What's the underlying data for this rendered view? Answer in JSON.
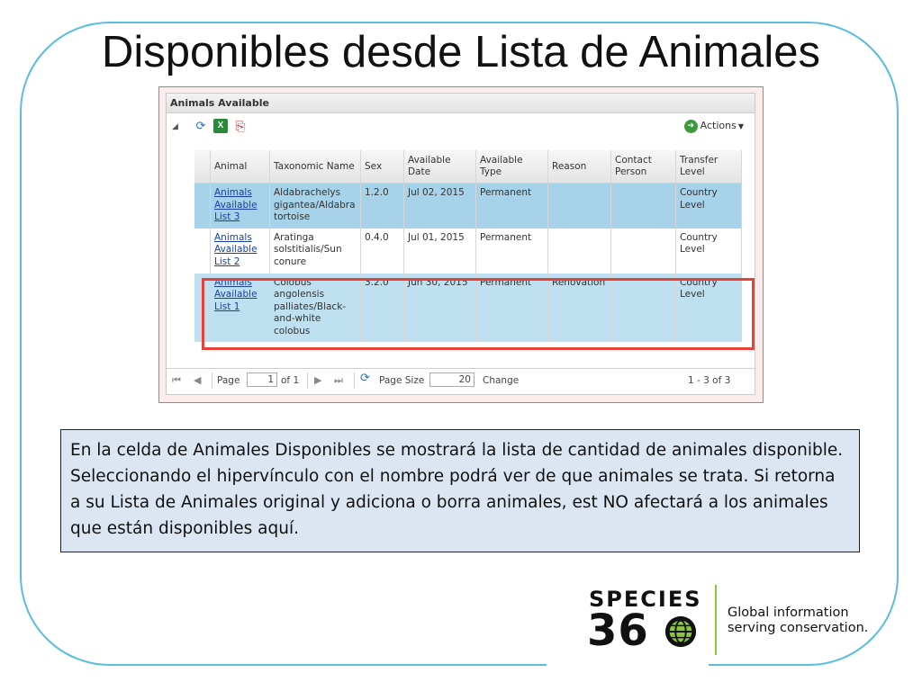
{
  "slide": {
    "title": "Disponibles desde Lista de Animales"
  },
  "panel": {
    "title": "Animals Available",
    "toolbar": {
      "icons": [
        "refresh-icon",
        "excel-export-icon",
        "pdf-export-icon"
      ],
      "actions_label": "Actions"
    },
    "columns": [
      "Animal",
      "Taxonomic Name",
      "Sex",
      "Available Date",
      "Available Type",
      "Reason",
      "Contact Person",
      "Transfer Level"
    ],
    "rows": [
      {
        "animal": "Animals Available List 3",
        "taxonomic_name": "Aldabrachelys gigantea/Aldabra tortoise",
        "sex": "1.2.0",
        "available_date": "Jul 02, 2015",
        "available_type": "Permanent",
        "reason": "",
        "contact_person": "",
        "transfer_level": "Country Level"
      },
      {
        "animal": "Animals Available List 2",
        "taxonomic_name": "Aratinga solstitialis/Sun conure",
        "sex": "0.4.0",
        "available_date": "Jul 01, 2015",
        "available_type": "Permanent",
        "reason": "",
        "contact_person": "",
        "transfer_level": "Country Level"
      },
      {
        "animal": "Animals Available List 1",
        "taxonomic_name": "Colobus angolensis palliates/Black-and-white colobus",
        "sex": "3.2.0",
        "available_date": "Jun 30, 2015",
        "available_type": "Permanent",
        "reason": "Renovation",
        "contact_person": "",
        "transfer_level": "Country Level"
      }
    ],
    "pager": {
      "page_label": "Page",
      "page_value": "1",
      "of_label": "of 1",
      "page_size_label": "Page Size",
      "page_size_value": "20",
      "change_label": "Change",
      "range_text": "1 - 3 of 3"
    }
  },
  "note": {
    "text": "En la celda de Animales Disponibles se mostrará la lista de cantidad de animales disponible.  Seleccionando el hipervínculo con el nombre podrá ver de que animales se trata. Si retorna a su Lista de Animales original  y adiciona o borra animales, est NO afectará a los animales que están disponibles aquí."
  },
  "logo": {
    "word": "SPECIES",
    "number_prefix": "36",
    "tagline_line1": "Global information",
    "tagline_line2": "serving conservation."
  },
  "colors": {
    "frame": "#58bde0",
    "row_highlight": "#a7d3ea",
    "selection_box": "#e2433a",
    "note_background": "#dce6f2",
    "logo_divider": "#8cc63f"
  }
}
